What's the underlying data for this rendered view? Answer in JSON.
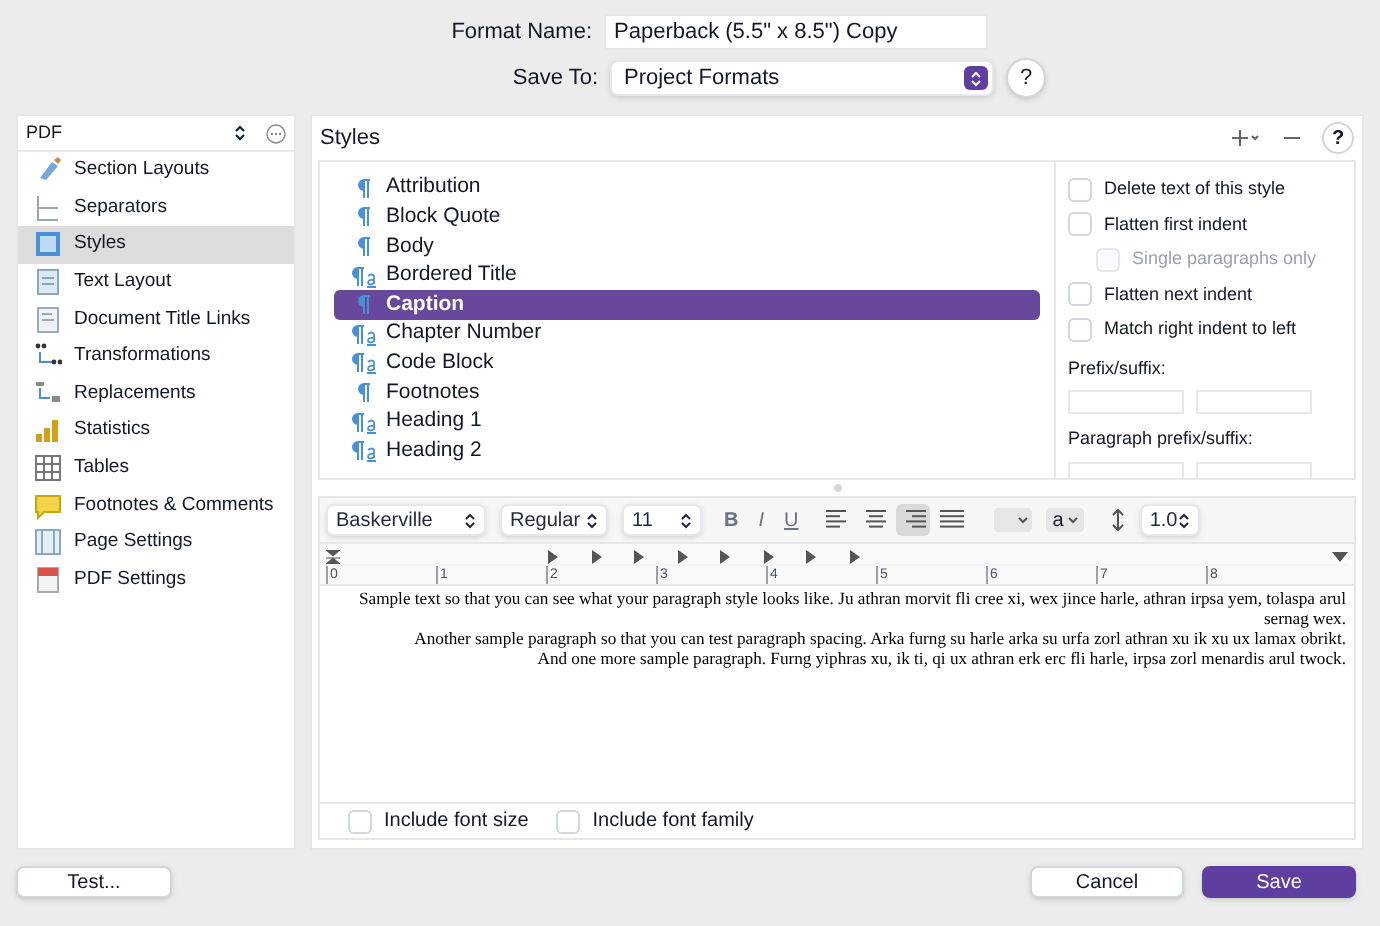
{
  "format_name": {
    "label": "Format Name:",
    "value": "Paperback (5.5\" x 8.5\") Copy"
  },
  "save_to": {
    "label": "Save To:",
    "value": "Project Formats",
    "help": "?"
  },
  "sidebar": {
    "format": "PDF",
    "items": [
      {
        "label": "Section Layouts",
        "selected": false
      },
      {
        "label": "Separators",
        "selected": false
      },
      {
        "label": "Styles",
        "selected": true
      },
      {
        "label": "Text Layout",
        "selected": false
      },
      {
        "label": "Document Title Links",
        "selected": false
      },
      {
        "label": "Transformations",
        "selected": false
      },
      {
        "label": "Replacements",
        "selected": false
      },
      {
        "label": "Statistics",
        "selected": false
      },
      {
        "label": "Tables",
        "selected": false
      },
      {
        "label": "Footnotes & Comments",
        "selected": false
      },
      {
        "label": "Page Settings",
        "selected": false
      },
      {
        "label": "PDF Settings",
        "selected": false
      }
    ]
  },
  "styles": {
    "title": "Styles",
    "help": "?",
    "items": [
      {
        "name": "Attribution",
        "kind": "paragraph",
        "selected": false
      },
      {
        "name": "Block Quote",
        "kind": "paragraph",
        "selected": false
      },
      {
        "name": "Body",
        "kind": "paragraph",
        "selected": false
      },
      {
        "name": "Bordered Title",
        "kind": "combined",
        "selected": false
      },
      {
        "name": "Caption",
        "kind": "paragraph",
        "selected": true
      },
      {
        "name": "Chapter Number",
        "kind": "combined",
        "selected": false
      },
      {
        "name": "Code Block",
        "kind": "combined",
        "selected": false
      },
      {
        "name": "Footnotes",
        "kind": "paragraph",
        "selected": false
      },
      {
        "name": "Heading 1",
        "kind": "combined",
        "selected": false
      },
      {
        "name": "Heading 2",
        "kind": "combined",
        "selected": false
      }
    ]
  },
  "options": [
    {
      "label": "Delete text of this style",
      "checked": false,
      "disabled": false,
      "indented": false
    },
    {
      "label": "Flatten first indent",
      "checked": false,
      "disabled": false,
      "indented": false
    },
    {
      "label": "Single paragraphs only",
      "checked": false,
      "disabled": true,
      "indented": true
    },
    {
      "label": "Flatten next indent",
      "checked": false,
      "disabled": false,
      "indented": false
    },
    {
      "label": "Match right indent to left",
      "checked": false,
      "disabled": false,
      "indented": false
    }
  ],
  "prefix_suffix": {
    "label": "Prefix/suffix:"
  },
  "paragraph_prefix_suffix": {
    "label": "Paragraph prefix/suffix:"
  },
  "toolbar": {
    "font": "Baskerville",
    "weight": "Regular",
    "size": "11",
    "bold": "B",
    "italic": "I",
    "underline": "U",
    "format_disabled": true,
    "alignments": [
      {
        "kind": "left",
        "selected": false
      },
      {
        "kind": "center",
        "selected": false
      },
      {
        "kind": "right",
        "selected": true
      },
      {
        "kind": "justify",
        "selected": false
      }
    ],
    "char_style": "a",
    "line_spacing": "1.0"
  },
  "ruler": {
    "numbers": [
      "0",
      "1",
      "2",
      "3",
      "4",
      "5",
      "6",
      "7",
      "8"
    ]
  },
  "sample_paragraphs": [
    "Sample text so that you can see what your paragraph style looks like. Ju athran morvit fli cree xi, wex jince harle, athran irpsa yem, tolaspa arul sernag wex.",
    "Another sample paragraph so that you can test paragraph spacing. Arka furng su harle arka su urfa zorl athran xu ik xu ux lamax obrikt.",
    "And one more sample paragraph. Furng yiphras xu, ik ti, qi ux athran erk erc fli harle, irpsa zorl menardis arul twock."
  ],
  "include": [
    {
      "label": "Include font size",
      "checked": false
    },
    {
      "label": "Include font family",
      "checked": false
    }
  ],
  "buttons": {
    "test": "Test...",
    "cancel": "Cancel",
    "save": "Save"
  }
}
